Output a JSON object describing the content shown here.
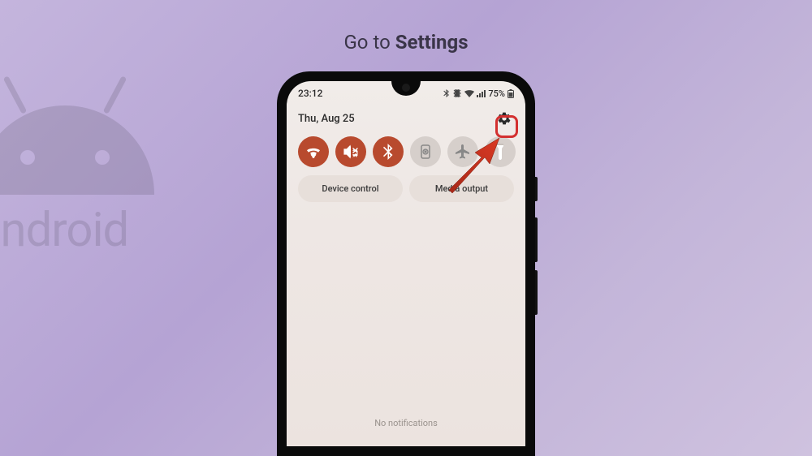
{
  "title": {
    "prefix": "Go to ",
    "bold": "Settings"
  },
  "android_label": "android",
  "status": {
    "time": "23:12",
    "battery": "75%"
  },
  "date": "Thu, Aug 25",
  "tiles": [
    {
      "name": "wifi",
      "active": true
    },
    {
      "name": "mute-vibrate",
      "active": true
    },
    {
      "name": "bluetooth",
      "active": true
    },
    {
      "name": "rotation-lock",
      "active": false
    },
    {
      "name": "airplane",
      "active": false
    },
    {
      "name": "flashlight",
      "active": false
    }
  ],
  "buttons": {
    "device_control": "Device control",
    "media_output": "Media output"
  },
  "no_notifications": "No notifications"
}
